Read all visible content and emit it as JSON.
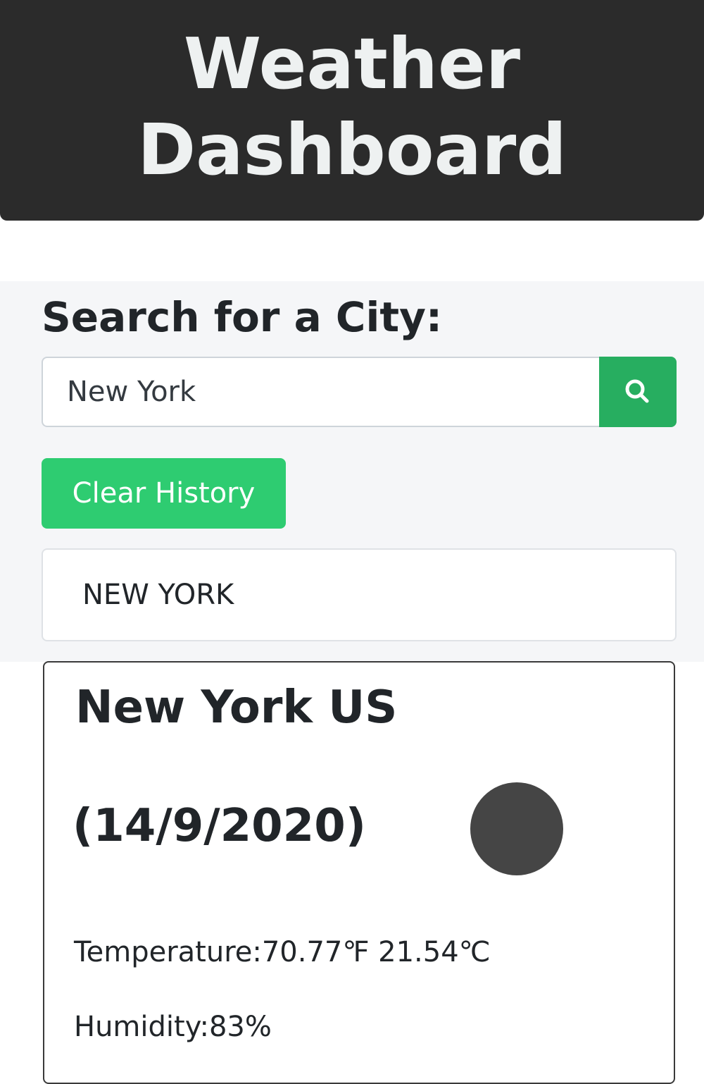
{
  "header": {
    "title": "Weather Dashboard"
  },
  "search": {
    "heading": "Search for a City:",
    "input_value": "New York",
    "button_icon": "search-icon",
    "clear_label": "Clear History"
  },
  "history": {
    "items": [
      {
        "label": "NEW YORK"
      }
    ]
  },
  "current": {
    "city": "New York US",
    "date": "(14/9/2020)",
    "icon": "weather-icon",
    "temperature_label": "Temperature:",
    "temperature_value": "70.77℉ 21.54℃",
    "humidity_label": "Humidity:",
    "humidity_value": "83%"
  },
  "colors": {
    "header_bg": "#2b2b2b",
    "accent_green": "#27ae60",
    "clear_green": "#2ecc71",
    "panel_bg": "#f5f6f8"
  }
}
